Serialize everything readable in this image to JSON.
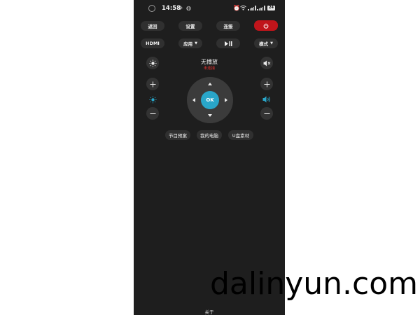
{
  "status_bar": {
    "time": "14:58",
    "battery": "24",
    "icons": [
      "camera-dot-icon",
      "airplane-icon",
      "sync-icon",
      "alarm-icon",
      "wifi-icon",
      "signal-icon",
      "signal-icon",
      "battery-icon"
    ]
  },
  "top_row": {
    "back": "返回",
    "settings": "设置",
    "connect": "连接",
    "power_icon": "power-icon",
    "power_color": "#c0151b"
  },
  "second_row": {
    "hdmi": "HDMI",
    "apps": "应用",
    "play_pause_icon": "play-pause-icon",
    "mode": "模式"
  },
  "now_playing": {
    "title": "无播放",
    "subtitle": "未连接",
    "subtitle_color": "#e0322f"
  },
  "left_controls": {
    "icons": [
      "brightness-icon",
      "plus-icon",
      "brightness-icon",
      "minus-icon"
    ]
  },
  "right_controls": {
    "icons": [
      "mute-icon",
      "plus-icon",
      "volume-icon",
      "minus-icon"
    ],
    "volume_color": "#29a6c9"
  },
  "dpad": {
    "ok_label": "OK",
    "ok_color": "#29a6c9"
  },
  "shortcuts": {
    "program_preview": "节目预案",
    "my_computer": "我的电脑",
    "usb_material": "U盘素材"
  },
  "footer": {
    "about": "关于"
  },
  "watermark": {
    "text": "dalinyun.com"
  }
}
